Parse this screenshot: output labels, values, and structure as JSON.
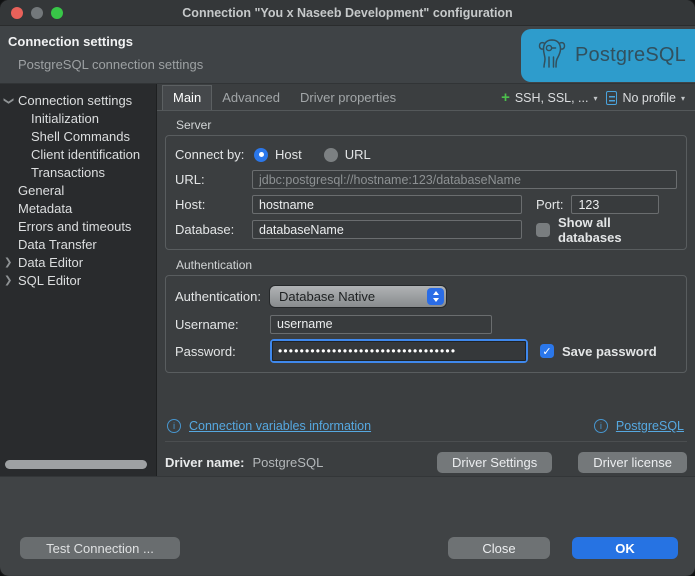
{
  "window": {
    "title": "Connection \"You x Naseeb Development\" configuration"
  },
  "header": {
    "title": "Connection settings",
    "subtitle": "PostgreSQL connection settings",
    "logo_label": "PostgreSQL",
    "logo_bg": "#2e9ccc"
  },
  "sidebar": {
    "items": [
      {
        "label": "Connection settings"
      },
      {
        "label": "Initialization"
      },
      {
        "label": "Shell Commands"
      },
      {
        "label": "Client identification"
      },
      {
        "label": "Transactions"
      },
      {
        "label": "General"
      },
      {
        "label": "Metadata"
      },
      {
        "label": "Errors and timeouts"
      },
      {
        "label": "Data Transfer"
      },
      {
        "label": "Data Editor"
      },
      {
        "label": "SQL Editor"
      }
    ]
  },
  "tabs": {
    "items": [
      {
        "label": "Main"
      },
      {
        "label": "Advanced"
      },
      {
        "label": "Driver properties"
      }
    ]
  },
  "toolbar": {
    "ssh_label": "SSH, SSL, ...",
    "profile_label": "No profile"
  },
  "server": {
    "group_label": "Server",
    "connect_by_label": "Connect by:",
    "host_radio_label": "Host",
    "url_radio_label": "URL",
    "url_label": "URL:",
    "url_value": "jdbc:postgresql://hostname:123/databaseName",
    "host_label": "Host:",
    "host_value": "hostname",
    "port_label": "Port:",
    "port_value": "123",
    "database_label": "Database:",
    "database_value": "databaseName",
    "show_all_databases_label": "Show all databases"
  },
  "auth": {
    "group_label": "Authentication",
    "auth_label": "Authentication:",
    "auth_value": "Database Native",
    "username_label": "Username:",
    "username_value": "username",
    "password_label": "Password:",
    "password_masked": "•••••••••••••••••••••••••••••••••",
    "save_password_label": "Save password"
  },
  "links": {
    "variables_label": "Connection variables information",
    "driver_link_label": "PostgreSQL"
  },
  "driver": {
    "name_label": "Driver name:",
    "name_value": "PostgreSQL",
    "settings_button": "Driver Settings",
    "license_button": "Driver license"
  },
  "footer": {
    "test_button": "Test Connection ...",
    "close_button": "Close",
    "ok_button": "OK"
  },
  "colors": {
    "accent": "#2b77ea",
    "link": "#56a8e0",
    "logo_bg": "#2e9ccc"
  }
}
